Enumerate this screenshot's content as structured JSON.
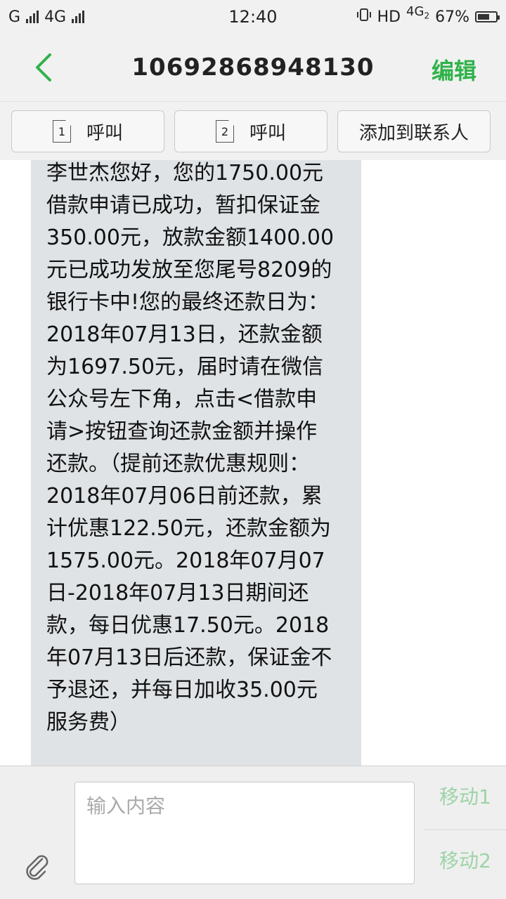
{
  "status": {
    "carrier1": "G",
    "carrier2": "4G",
    "time": "12:40",
    "hd": "HD",
    "net": "4G",
    "net_sub": "2",
    "battery": "67%",
    "battery_level": 0.67
  },
  "header": {
    "title": "10692868948130",
    "edit_label": "编辑"
  },
  "actions": {
    "call1_sim": "1",
    "call1_label": "呼叫",
    "call2_sim": "2",
    "call2_label": "呼叫",
    "add_contact_label": "添加到联系人"
  },
  "message": {
    "text": "李世杰您好，您的1750.00元\n借款申请已成功，暂扣保证金\n350.00元，放款金额1400.00\n元已成功发放至您尾号8209的\n银行卡中!您的最终还款日为：\n2018年07月13日，还款金额\n为1697.50元，届时请在微信\n公众号左下角，点击<借款申\n请>按钮查询还款金额并操作\n还款。（提前还款优惠规则：\n2018年07月06日前还款，累\n计优惠122.50元，还款金额为\n1575.00元。2018年07月07\n日-2018年07月13日期间还\n款，每日优惠17.50元。2018\n年07月13日后还款，保证金不\n予退还，并每日加收35.00元\n服务费）"
  },
  "composer": {
    "placeholder": "输入内容",
    "send1_label": "移动1",
    "send2_label": "移动2"
  },
  "colors": {
    "accent": "#2fb24a",
    "bubble": "#dfe3e6",
    "send_disabled": "#9ed3a8"
  }
}
